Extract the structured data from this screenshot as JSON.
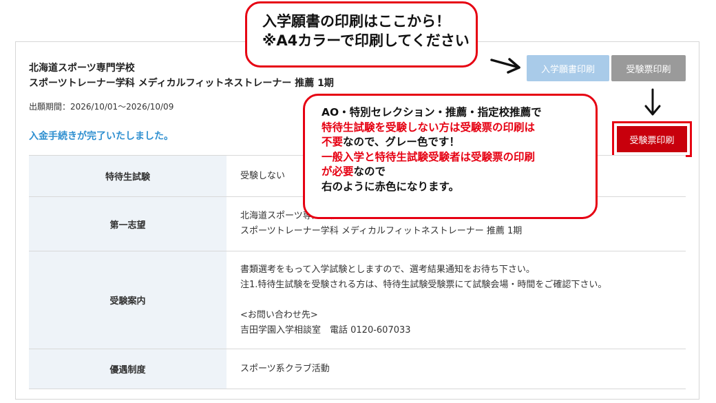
{
  "header": {
    "school_name": "北海道スポーツ専門学校",
    "course_name": "スポーツトレーナー学科 メディカルフィットネストレーナー 推薦 1期",
    "period": "出願期間：2026/10/01〜2026/10/09",
    "payment_status": "入金手続きが完了いたしました。"
  },
  "buttons": {
    "application_print": "入学願書印刷",
    "ticket_print_gray": "受験票印刷",
    "ticket_print_red": "受験票印刷"
  },
  "table": {
    "rows": [
      {
        "label": "特待生試験",
        "lines": [
          "受験しない"
        ]
      },
      {
        "label": "第一志望",
        "lines": [
          "北海道スポーツ専門学校",
          "スポーツトレーナー学科 メディカルフィットネストレーナー 推薦 1期"
        ]
      },
      {
        "label": "受験案内",
        "lines": [
          "書類選考をもって入学試験としますので、選考結果通知をお待ち下さい。",
          "注1.特待生試験を受験される方は、特待生試験受験票にて試験会場・時間をご確認下さい。",
          "",
          "<お問い合わせ先>",
          "吉田学園入学相談室　電話 0120-607033"
        ]
      },
      {
        "label": "優遇制度",
        "lines": [
          "スポーツ系クラブ活動"
        ]
      }
    ]
  },
  "callouts": {
    "print_note": {
      "line1": "入学願書の印刷はここから！",
      "line2": "※A4カラーで印刷してください"
    },
    "ticket_note": {
      "line1": "AO・特別セレクション・推薦・指定校推薦で",
      "line2_red": "特待生試験を受験しない方は受験票の印刷は",
      "line3_red": "不要",
      "line3_rest": "なので、グレー色です！",
      "line4_red": "一般入学と特待生試験受験者は受験票の印刷",
      "line5_red": "が必要",
      "line5_rest": "なので",
      "line6": "右のように赤色になります。"
    }
  },
  "colors": {
    "accent_blue": "#2e8fd0",
    "callout_red": "#e60012",
    "button_red": "#c8000c",
    "button_gray": "#9a9a9a",
    "button_lightblue": "#a9cbe9"
  }
}
